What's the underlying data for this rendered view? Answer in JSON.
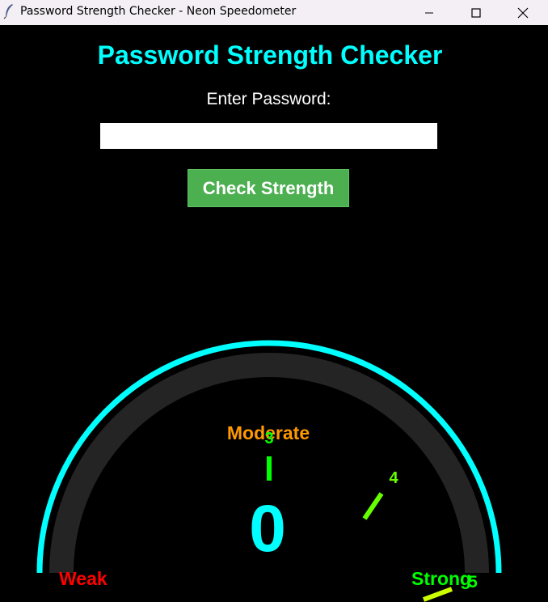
{
  "window": {
    "title": "Password Strength Checker - Neon Speedometer",
    "icon": "feather-icon",
    "controls": [
      "minimize-icon",
      "maximize-icon",
      "close-icon"
    ]
  },
  "app": {
    "heading": "Password Strength Checker",
    "prompt_label": "Enter Password:",
    "password_value": "",
    "check_button_label": "Check Strength"
  },
  "gauge": {
    "score": "0",
    "labels": {
      "weak": "Weak",
      "moderate": "Moderate",
      "strong": "Strong"
    },
    "ticks": [
      {
        "label": "3",
        "color": "#00ff00"
      },
      {
        "label": "4",
        "color": "#66ff00"
      },
      {
        "label": "5",
        "color": "#ccff00"
      }
    ],
    "colors": {
      "heading": "#00ffff",
      "outer_arc": "#00ffff",
      "inner_arc": "#242424",
      "score": "#00ffff",
      "weak": "#ff0000",
      "moderate": "#ff9900",
      "strong": "#00ff00",
      "button": "#4caf50"
    }
  }
}
